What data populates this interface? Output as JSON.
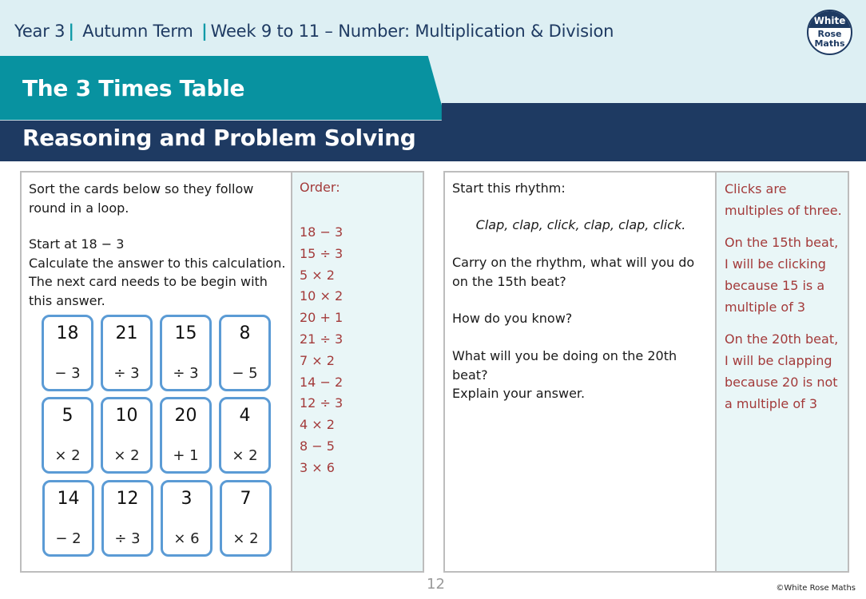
{
  "header": {
    "breadcrumb": {
      "year": "Year 3",
      "term": "Autumn Term",
      "unit": "Week 9 to 11 – Number: Multiplication & Division",
      "separator": "|"
    },
    "logo": {
      "line1": "White",
      "line2": "Rose",
      "line3": "Maths"
    },
    "title": "The 3 Times Table",
    "subtitle": "Reasoning and Problem Solving"
  },
  "colors": {
    "navy": "#1e3a62",
    "teal": "#0892a0",
    "light_band": "#ddeff3",
    "answer_bg": "#e9f6f7",
    "answer_text": "#a33a3a",
    "card_border": "#5b9bd5"
  },
  "left_task": {
    "instruction1": "Sort the cards below so they follow round in a loop.",
    "instruction2_line1": "Start at 18 − 3",
    "instruction2_line2": "Calculate the answer to this calculation.",
    "instruction2_line3": "The next card needs to be begin with this answer.",
    "cards": [
      {
        "number": "18",
        "operation": "− 3"
      },
      {
        "number": "21",
        "operation": "÷ 3"
      },
      {
        "number": "15",
        "operation": "÷ 3"
      },
      {
        "number": "8",
        "operation": "− 5"
      },
      {
        "number": "5",
        "operation": "× 2"
      },
      {
        "number": "10",
        "operation": "× 2"
      },
      {
        "number": "20",
        "operation": "+ 1"
      },
      {
        "number": "4",
        "operation": "× 2"
      },
      {
        "number": "14",
        "operation": "− 2"
      },
      {
        "number": "12",
        "operation": "÷ 3"
      },
      {
        "number": "3",
        "operation": "× 6"
      },
      {
        "number": "7",
        "operation": "× 2"
      }
    ],
    "answer": {
      "label": "Order:",
      "order": [
        "18 − 3",
        "15 ÷ 3",
        "5 × 2",
        "10 × 2",
        "20 + 1",
        "21 ÷ 3",
        "7 × 2",
        "14 − 2",
        "12 ÷ 3",
        "4 × 2",
        "8 − 5",
        "3 × 6"
      ]
    }
  },
  "right_task": {
    "line1": "Start this rhythm:",
    "rhythm": "Clap, clap, click, clap, clap, click.",
    "line2": "Carry on the rhythm, what will you do on the 15th beat?",
    "line3": "How do you know?",
    "line4": "What will you be doing on the 20th beat?",
    "line5": "Explain your answer.",
    "answer": {
      "para1": "Clicks are multiples of three.",
      "para2": "On the 15th beat, I will be clicking because 15 is a multiple of 3",
      "para3": "On the 20th beat, I will be clapping because 20 is not a multiple of 3"
    }
  },
  "footer": {
    "page_number": "12",
    "copyright": "©White Rose Maths"
  }
}
